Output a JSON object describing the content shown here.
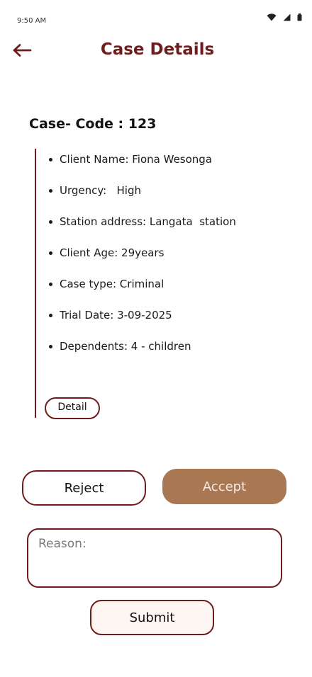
{
  "status_bar": {
    "time": "9:50 AM",
    "icons": [
      "wifi-icon",
      "cell-signal-icon",
      "battery-icon"
    ]
  },
  "app_bar": {
    "title": "Case Details",
    "back_icon": "arrow-left-icon"
  },
  "case": {
    "code_label": "Case- Code : 123",
    "details": [
      "Client Name: Fiona Wesonga",
      "Urgency:   High",
      "Station address: Langata  station",
      "Client Age: 29years",
      "Case type: Criminal",
      "Trial Date: 3-09-2025",
      "Dependents: 4 - children"
    ],
    "detail_button": "Detail"
  },
  "actions": {
    "reject": "Reject",
    "accept": "Accept"
  },
  "reason": {
    "placeholder": "Reason:",
    "value": ""
  },
  "submit": "Submit",
  "colors": {
    "primary": "#6e1d1d",
    "accept_bg": "#a97752",
    "accept_text": "#f4ebe4",
    "submit_bg": "#fdf6f2"
  }
}
